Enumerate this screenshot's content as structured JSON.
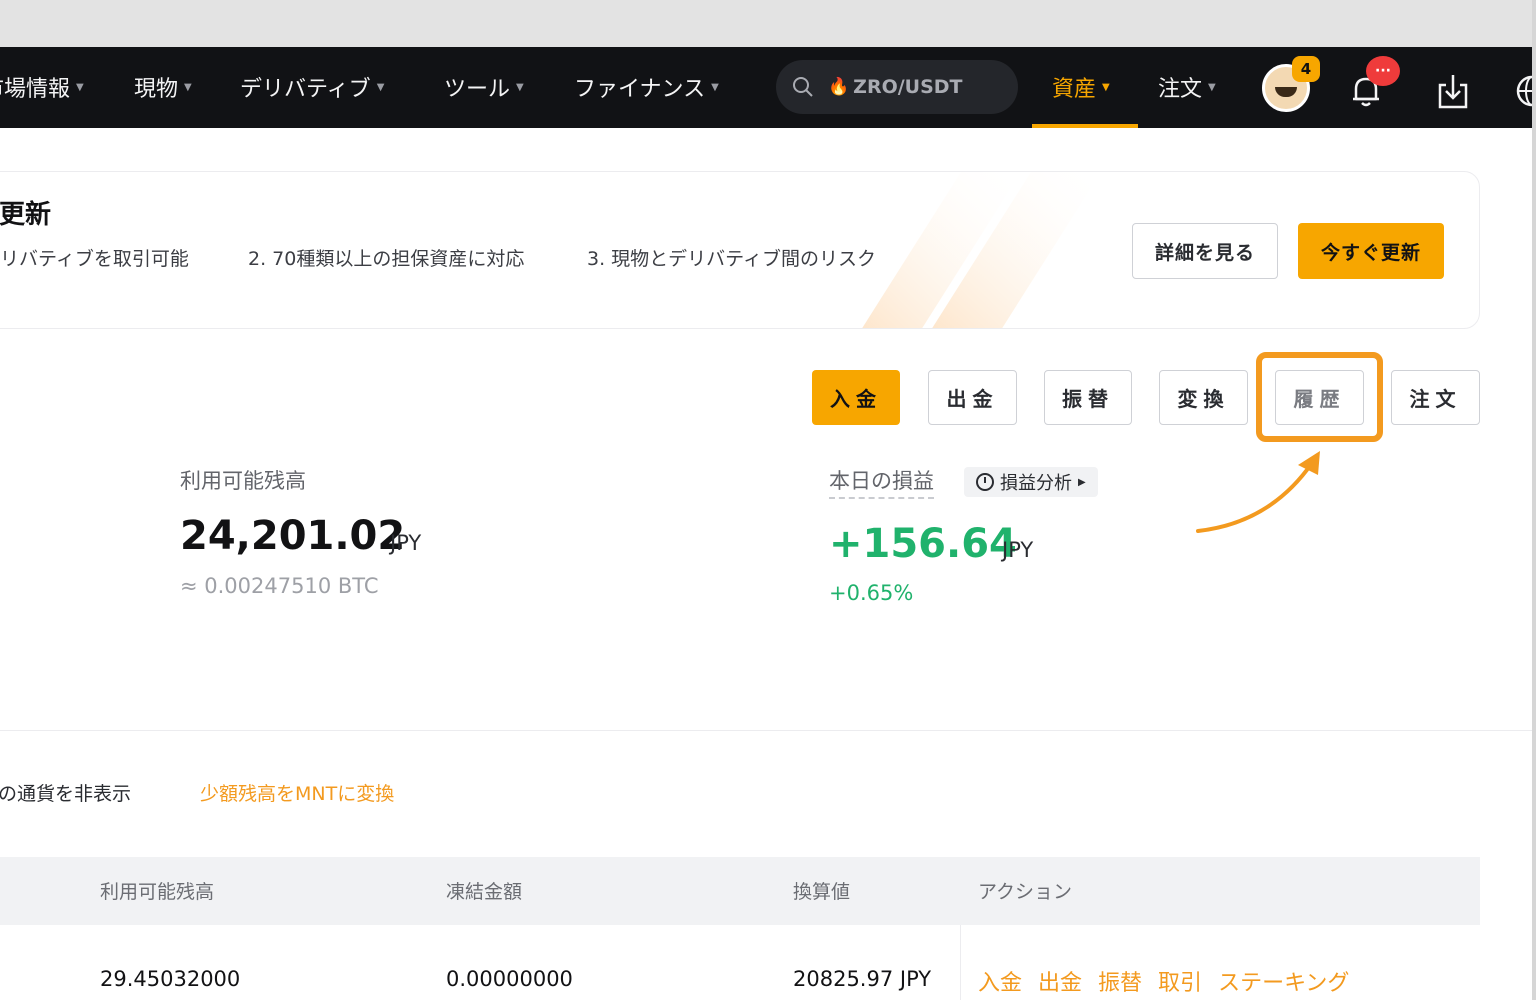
{
  "nav": {
    "items": [
      {
        "label": "市場情報"
      },
      {
        "label": "現物"
      },
      {
        "label": "デリバティブ"
      },
      {
        "label": "ツール"
      },
      {
        "label": "ファイナンス"
      },
      {
        "label": "資産"
      },
      {
        "label": "注文"
      }
    ],
    "search_value": "ZRO/USDT",
    "avatar_badge": "4",
    "bell_badge": "···"
  },
  "banner": {
    "title": "更新",
    "points": [
      "デリバティブを取引可能",
      "2. 70種類以上の担保資産に対応",
      "3. 現物とデリバティブ間のリスク"
    ],
    "details_label": "詳細を見る",
    "upgrade_label": "今すぐ更新"
  },
  "actions": {
    "deposit": "入金",
    "withdraw": "出金",
    "transfer": "振替",
    "convert": "変換",
    "history": "履歴",
    "orders": "注文"
  },
  "balance": {
    "label": "利用可能残高",
    "value": "24,201.02",
    "unit": "JPY",
    "btc": "≈ 0.00247510 BTC"
  },
  "pnl": {
    "label": "本日の損益",
    "analysis_link": "損益分析",
    "value": "+156.64",
    "unit": "JPY",
    "percent": "+0.65%"
  },
  "filters": {
    "hide_zero": "ゼロの通貨を非表示",
    "convert_small": "少額残高をMNTに変換"
  },
  "table": {
    "headers": [
      "利用可能残高",
      "凍結金額",
      "換算値",
      "アクション"
    ],
    "rows": [
      {
        "available": "29.45032000",
        "frozen": "0.00000000",
        "converted": "20825.97 JPY",
        "actions": [
          "入金",
          "出金",
          "振替",
          "取引",
          "ステーキング"
        ]
      }
    ]
  },
  "colors": {
    "accent": "#f7a600",
    "positive": "#20b26c",
    "nav_bg": "#111215",
    "highlight": "#f39a1f"
  }
}
